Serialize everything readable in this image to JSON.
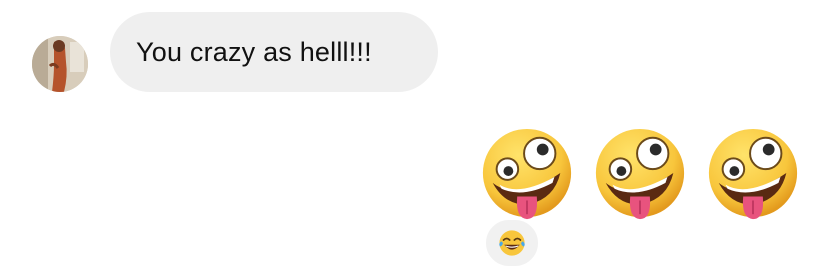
{
  "conversation": {
    "incoming": {
      "text": "You crazy as helll!!!"
    },
    "outgoing": {
      "emojis": [
        "zany-face",
        "zany-face",
        "zany-face"
      ],
      "reaction": "face-with-tears-of-joy"
    }
  },
  "colors": {
    "incoming_bubble": "#efefef",
    "incoming_text": "#111111",
    "reaction_bg": "#f1f1f1",
    "emoji_yellow": "#f8c63c",
    "emoji_tongue": "#e8537e"
  }
}
